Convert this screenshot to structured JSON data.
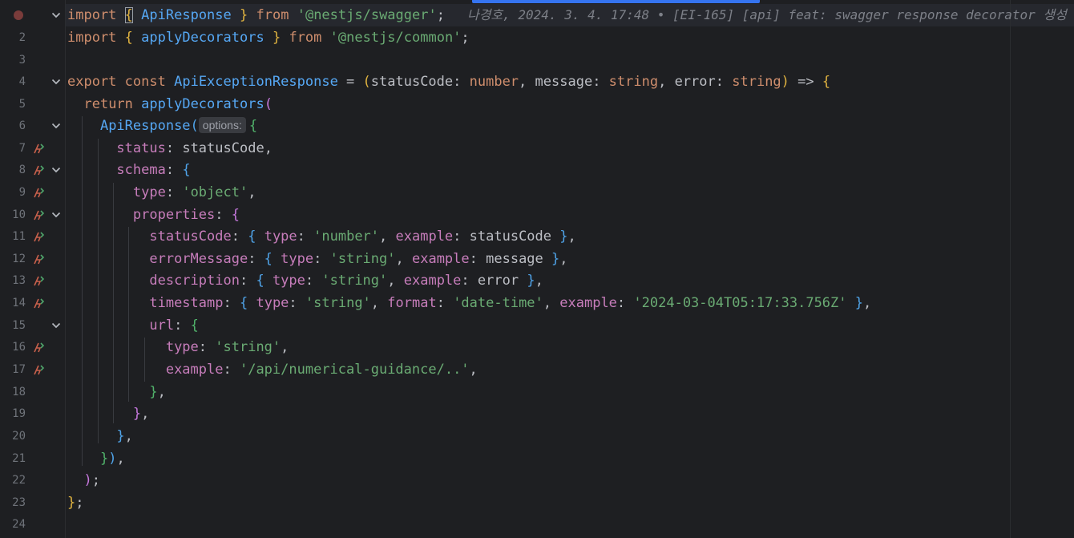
{
  "editor": {
    "inline_blame": "나경호, 2024. 3. 4. 17:48 • [EI-165] [api] feat: swagger response decorator 생성",
    "param_hint": "options:",
    "line_numbers": [
      "2",
      "3",
      "4",
      "5",
      "6",
      "7",
      "8",
      "9",
      "10",
      "11",
      "12",
      "13",
      "14",
      "15",
      "16",
      "17",
      "18",
      "19",
      "20",
      "21",
      "22",
      "23",
      "24"
    ],
    "colors": {
      "background": "#1e1f22",
      "keyword": "#cf8e6d",
      "function": "#56a8f5",
      "string": "#6aab73",
      "property": "#c77dbb",
      "scroll_indicator": "#3574f0"
    }
  },
  "code": {
    "l1": {
      "kw1": "import",
      "b1": "{",
      "id": "ApiResponse",
      "b2": "}",
      "kw2": "from",
      "str": "'@nestjs/swagger'",
      "end": ";"
    },
    "l2": {
      "kw1": "import",
      "b1": "{",
      "id": "applyDecorators",
      "b2": "}",
      "kw2": "from",
      "str": "'@nestjs/common'",
      "end": ";"
    },
    "l4": {
      "kw1": "export",
      "kw2": "const",
      "name": "ApiExceptionResponse",
      "eq": " = ",
      "po": "(",
      "p1": "statusCode",
      "c1": ": ",
      "t1": "number",
      "s1": ", ",
      "p2": "message",
      "c2": ": ",
      "t2": "string",
      "s2": ", ",
      "p3": "error",
      "c3": ": ",
      "t3": "string",
      "pc": ")",
      "arrow": " => ",
      "bo": "{"
    },
    "l5": {
      "kw": "return",
      "fn": "applyDecorators",
      "po": "("
    },
    "l6": {
      "fn": "ApiResponse",
      "po": "(",
      "bo": "{"
    },
    "l7": {
      "prop": "status",
      "colon": ": ",
      "val": "statusCode",
      "end": ","
    },
    "l8": {
      "prop": "schema",
      "colon": ": ",
      "bo": "{"
    },
    "l9": {
      "prop": "type",
      "colon": ": ",
      "str": "'object'",
      "end": ","
    },
    "l10": {
      "prop": "properties",
      "colon": ": ",
      "bo": "{"
    },
    "l11": {
      "prop": "statusCode",
      "colon": ": ",
      "bo": "{",
      "k1": "type",
      "str": "'number'",
      "k2": "example",
      "val": "statusCode",
      "bc": "}",
      "end": ","
    },
    "l12": {
      "prop": "errorMessage",
      "colon": ": ",
      "bo": "{",
      "k1": "type",
      "str": "'string'",
      "k2": "example",
      "val": "message",
      "bc": "}",
      "end": ","
    },
    "l13": {
      "prop": "description",
      "colon": ": ",
      "bo": "{",
      "k1": "type",
      "str": "'string'",
      "k2": "example",
      "val": "error",
      "bc": "}",
      "end": ","
    },
    "l14": {
      "prop": "timestamp",
      "colon": ": ",
      "bo": "{",
      "k1": "type",
      "str1": "'string'",
      "k2": "format",
      "str2": "'date-time'",
      "k3": "example",
      "str3": "'2024-03-04T05:17:33.756Z'",
      "bc": "}",
      "end": ","
    },
    "l15": {
      "prop": "url",
      "colon": ": ",
      "bo": "{"
    },
    "l16": {
      "prop": "type",
      "colon": ": ",
      "str": "'string'",
      "end": ","
    },
    "l17": {
      "prop": "example",
      "colon": ": ",
      "str": "'/api/numerical-guidance/..'",
      "end": ","
    },
    "l18": {
      "bc": "}",
      "end": ","
    },
    "l19": {
      "bc": "}",
      "end": ","
    },
    "l20": {
      "bc": "}",
      "end": ","
    },
    "l21": {
      "bc": "}",
      "pc": ")",
      "end": ","
    },
    "l22": {
      "pc": ")",
      "end": ";"
    },
    "l23": {
      "bc": "}",
      "end": ";"
    }
  }
}
